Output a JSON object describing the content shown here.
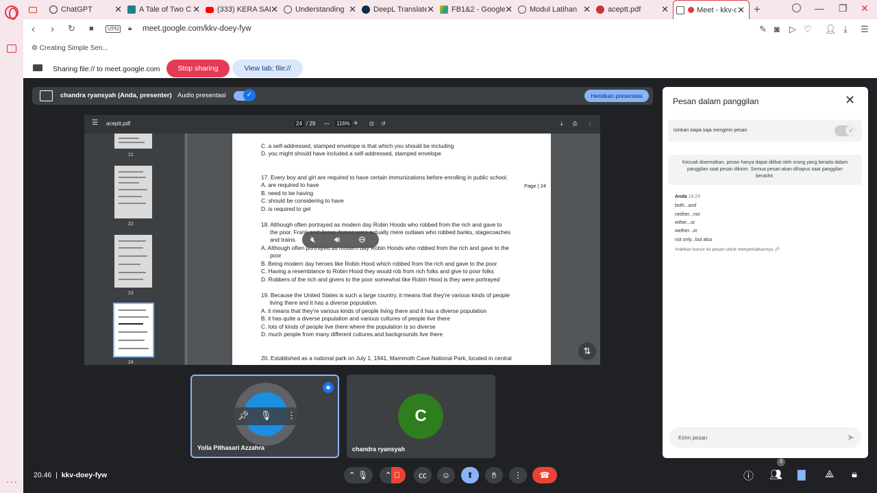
{
  "tabs": [
    {
      "label": "",
      "icon": "gmail-icon"
    },
    {
      "label": "ChatGPT",
      "icon": "chatgpt-icon"
    },
    {
      "label": "A Tale of Two C",
      "icon": "perplexity-icon"
    },
    {
      "label": "(333) KERA SAK",
      "icon": "youtube-icon"
    },
    {
      "label": "Understanding",
      "icon": "globe-icon"
    },
    {
      "label": "DeepL Translate",
      "icon": "deepl-icon"
    },
    {
      "label": "FB1&2 - Google",
      "icon": "drive-icon"
    },
    {
      "label": "Modul Latihan",
      "icon": "globe-icon"
    },
    {
      "label": "aceptt.pdf",
      "icon": "pdf-icon"
    },
    {
      "label": "Meet - kkv-d",
      "icon": "meet-icon",
      "active": true
    }
  ],
  "address": {
    "url": "meet.google.com/kkv-doey-fyw",
    "vpn": "VPN"
  },
  "share": {
    "tab_title": "Creating Simple Sen...",
    "label": "Sharing file:// to meet.google.com",
    "stop": "Stop sharing",
    "view": "View tab: file://"
  },
  "presenter": {
    "name": "chandra ryansyah (Anda, presenter)",
    "audio": "Audio presentasi",
    "stop": "Hentikan presentasi"
  },
  "pdf": {
    "filename": "aceptt.pdf",
    "page_current": "24",
    "page_total": "/ 29",
    "zoom": "116%",
    "thumb_labels": [
      "21",
      "22",
      "23",
      "24"
    ],
    "page_label": "Page | 24",
    "lines": [
      "C. a self-addressed, stamped envelope is that which you should be including",
      "D. you might should have included a self-addressed, stamped envelope",
      "17. Every boy and girl are required to have certain immunizations before enrolling in public school.",
      "A. are required to have",
      "B. need to be having",
      "C. should be considering to have",
      "D. is required to get",
      "18. Although often portrayed as modern day Robin Hoods who robbed from the rich and gave to",
      "the poor, Frank and Jesse James were actually mere outlaws who robbed banks, stagecoaches",
      "and trains.",
      "A. Although often portrayed as modern day Robin Hoods who robbed from the rich and gave to the",
      "poor",
      "B. Being modern day heroes like Robin Hood which robbed from the rich and gave to the poor",
      "C. Having a resemblance to Robin Hood they would rob from rich folks and give to poor folks",
      "D. Robbers of the rich and givers to the poor somewhat like Robin Hood is they were portrayed",
      "19. Because the United States is such a large country, it means that they're various kinds of people",
      "living there and it has a diverse population.",
      "A. it means that they're various kinds of people living there and it has a diverse population",
      "B. it has quite a diverse population and various cultures of people live there",
      "C. lots of kinds of people live there where the population is so diverse",
      "D. much people from many different cultures and backgrounds live there",
      "20. Established as a national park on July 1, 1941, Mammoth Cave National Park, located in central"
    ]
  },
  "participants": [
    {
      "name": "Yolla Pithasari Azzahra"
    },
    {
      "name": "chandra ryansyah",
      "initial": "C"
    }
  ],
  "meeting": {
    "time": "20.46",
    "code": "kkv-doey-fyw",
    "people_count": "3"
  },
  "chat": {
    "title": "Pesan dalam panggilan",
    "allow": "Izinkan siapa saja mengirim pesan",
    "info": "Kecuali disematkan, pesan hanya dapat dilihat oleh orang yang berada dalam panggilan saat pesan dikirim. Semua pesan akan dihapus saat panggilan berakhir.",
    "sender": "Anda",
    "sent_time": "19.29",
    "messages": [
      "both...and",
      "neither...nor",
      "either...or",
      "wether...or",
      "not only...but also"
    ],
    "hint": "Arahkan kursor ke pesan untuk menyematkannya",
    "placeholder": "Kirim pesan"
  },
  "colors": {
    "stop": "#e53a55",
    "accent": "#1a73e8",
    "end_call": "#ea4335",
    "meet_bg": "#202124"
  }
}
